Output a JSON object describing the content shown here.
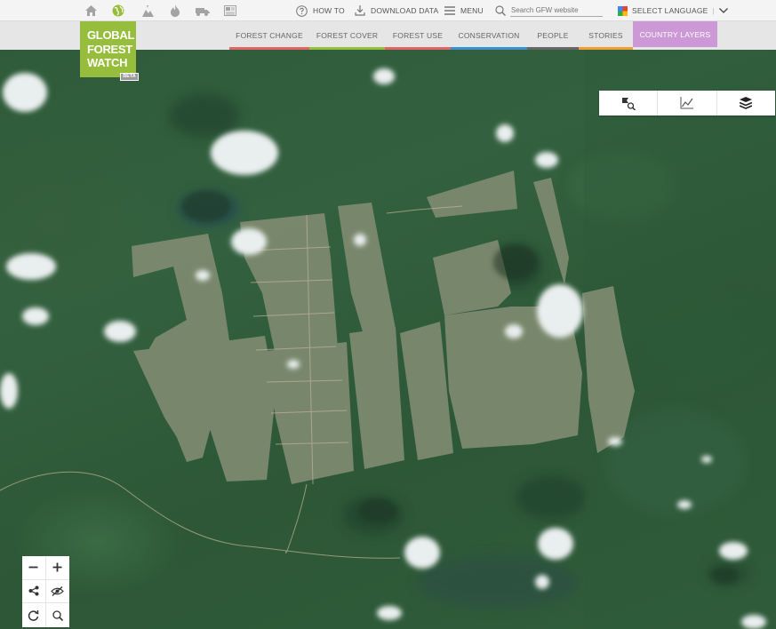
{
  "topbar": {
    "icons": [
      "home-icon",
      "globe-icon",
      "map-icon",
      "fire-icon",
      "truck-icon",
      "news-icon"
    ],
    "how_to": "HOW TO",
    "download_data": "DOWNLOAD DATA",
    "menu": "MENU",
    "search_placeholder": "Search GFW website",
    "select_language": "SELECT LANGUAGE"
  },
  "logo": {
    "line1": "GLOBAL",
    "line2": "FOREST",
    "line3": "WATCH",
    "beta": "BETA"
  },
  "nav": {
    "tabs": [
      {
        "label": "FOREST CHANGE",
        "color": "#e06666"
      },
      {
        "label": "FOREST COVER",
        "color": "#97bd3d"
      },
      {
        "label": "FOREST USE",
        "color": "#e06666"
      },
      {
        "label": "CONSERVATION",
        "color": "#3a8fcf"
      },
      {
        "label": "PEOPLE",
        "color": "#666666"
      },
      {
        "label": "STORIES",
        "color": "#f0a030"
      },
      {
        "label": "COUNTRY LAYERS",
        "color": "#cc99d6"
      }
    ]
  },
  "right_panel": {
    "tabs": [
      "analysis-icon",
      "chart-icon",
      "layers-icon"
    ]
  },
  "controls": {
    "buttons": [
      "zoom-out-icon",
      "zoom-in-icon",
      "share-icon",
      "hide-icon",
      "reset-icon",
      "search-icon"
    ]
  },
  "colors": {
    "brand": "#97bd3d",
    "forest": "#2f5a3a",
    "clearing": "#7f8e72"
  }
}
